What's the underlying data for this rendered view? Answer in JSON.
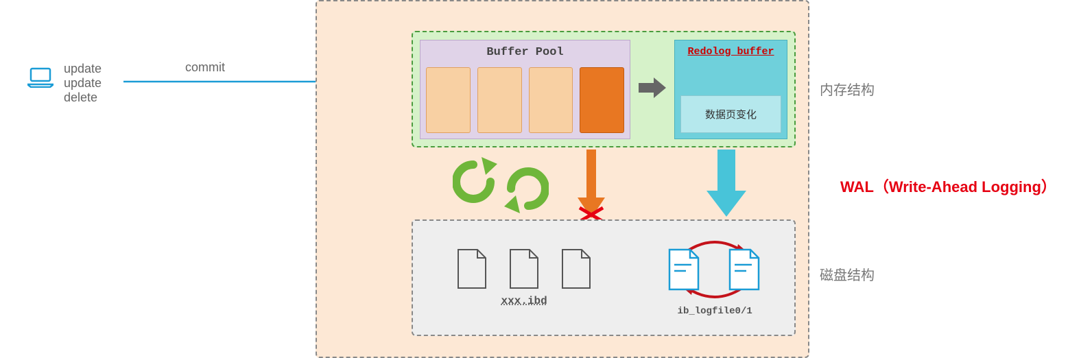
{
  "client": {
    "ops": [
      "update",
      "update",
      "delete"
    ]
  },
  "transition_label": "commit",
  "memory": {
    "buffer_pool_title": "Buffer Pool",
    "redolog_title": "Redolog buffer",
    "redolog_change": "数据页变化",
    "label": "内存结构"
  },
  "disk": {
    "ibd_filename": "xxx.ibd",
    "logfile_name": "ib_logfile0/1",
    "label": "磁盘结构"
  },
  "wal_label": "WAL（Write-Ahead Logging）"
}
